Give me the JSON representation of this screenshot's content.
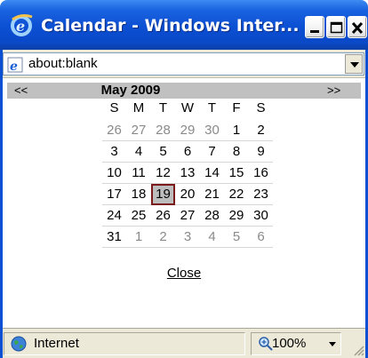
{
  "window": {
    "title": "Calendar - Windows Inter..."
  },
  "address": {
    "url": "about:blank"
  },
  "calendar": {
    "prev_label": "<<",
    "next_label": ">>",
    "month_title": "May 2009",
    "weekdays": [
      "S",
      "M",
      "T",
      "W",
      "T",
      "F",
      "S"
    ],
    "weeks": [
      [
        {
          "d": "26",
          "other": true
        },
        {
          "d": "27",
          "other": true
        },
        {
          "d": "28",
          "other": true
        },
        {
          "d": "29",
          "other": true
        },
        {
          "d": "30",
          "other": true
        },
        {
          "d": "1"
        },
        {
          "d": "2"
        }
      ],
      [
        {
          "d": "3"
        },
        {
          "d": "4"
        },
        {
          "d": "5"
        },
        {
          "d": "6"
        },
        {
          "d": "7"
        },
        {
          "d": "8"
        },
        {
          "d": "9"
        }
      ],
      [
        {
          "d": "10"
        },
        {
          "d": "11"
        },
        {
          "d": "12"
        },
        {
          "d": "13"
        },
        {
          "d": "14"
        },
        {
          "d": "15"
        },
        {
          "d": "16"
        }
      ],
      [
        {
          "d": "17"
        },
        {
          "d": "18"
        },
        {
          "d": "19",
          "selected": true
        },
        {
          "d": "20"
        },
        {
          "d": "21"
        },
        {
          "d": "22"
        },
        {
          "d": "23"
        }
      ],
      [
        {
          "d": "24"
        },
        {
          "d": "25"
        },
        {
          "d": "26"
        },
        {
          "d": "27"
        },
        {
          "d": "28"
        },
        {
          "d": "29"
        },
        {
          "d": "30"
        }
      ],
      [
        {
          "d": "31"
        },
        {
          "d": "1",
          "other": true
        },
        {
          "d": "2",
          "other": true
        },
        {
          "d": "3",
          "other": true
        },
        {
          "d": "4",
          "other": true
        },
        {
          "d": "5",
          "other": true
        },
        {
          "d": "6",
          "other": true
        }
      ]
    ],
    "close_label": "Close"
  },
  "status": {
    "zone": "Internet",
    "zoom": "100%"
  },
  "colors": {
    "titlebar": "#0b4fd2",
    "header_bg": "#c0c0c0",
    "selected_border": "#7a1a1a",
    "other_month": "#8a8a8a"
  }
}
